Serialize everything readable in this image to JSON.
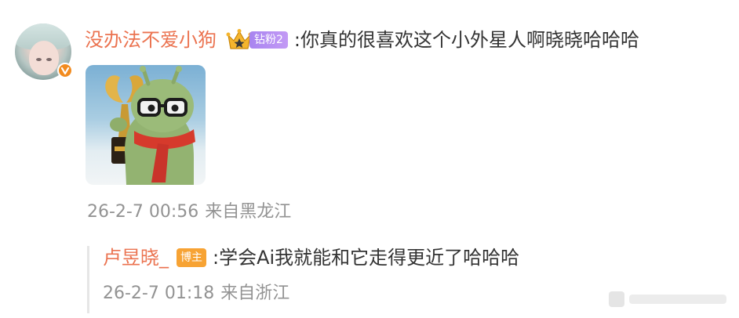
{
  "comment": {
    "username": "没办法不爱小狗",
    "rank_badge": "钻粉2",
    "text": ":你真的很喜欢这个小外星人啊晓晓哈哈哈",
    "date": "26-2-7 00:56",
    "location": "来自黑龙江",
    "image_icon": "alien-with-trophy-image",
    "avatar_badge_icon": "verified-badge-icon",
    "crown_icon": "crown-icon"
  },
  "reply": {
    "username": "卢昱晓_",
    "author_badge": "博主",
    "text": ":学会Ai我就能和它走得更近了哈哈哈",
    "date": "26-2-7 01:18",
    "location": "来自浙江"
  },
  "colors": {
    "username": "#eb7350",
    "meta": "#939393",
    "text": "#333333",
    "author_badge": "#f7a334",
    "rank_badge": "#b08cf2"
  }
}
